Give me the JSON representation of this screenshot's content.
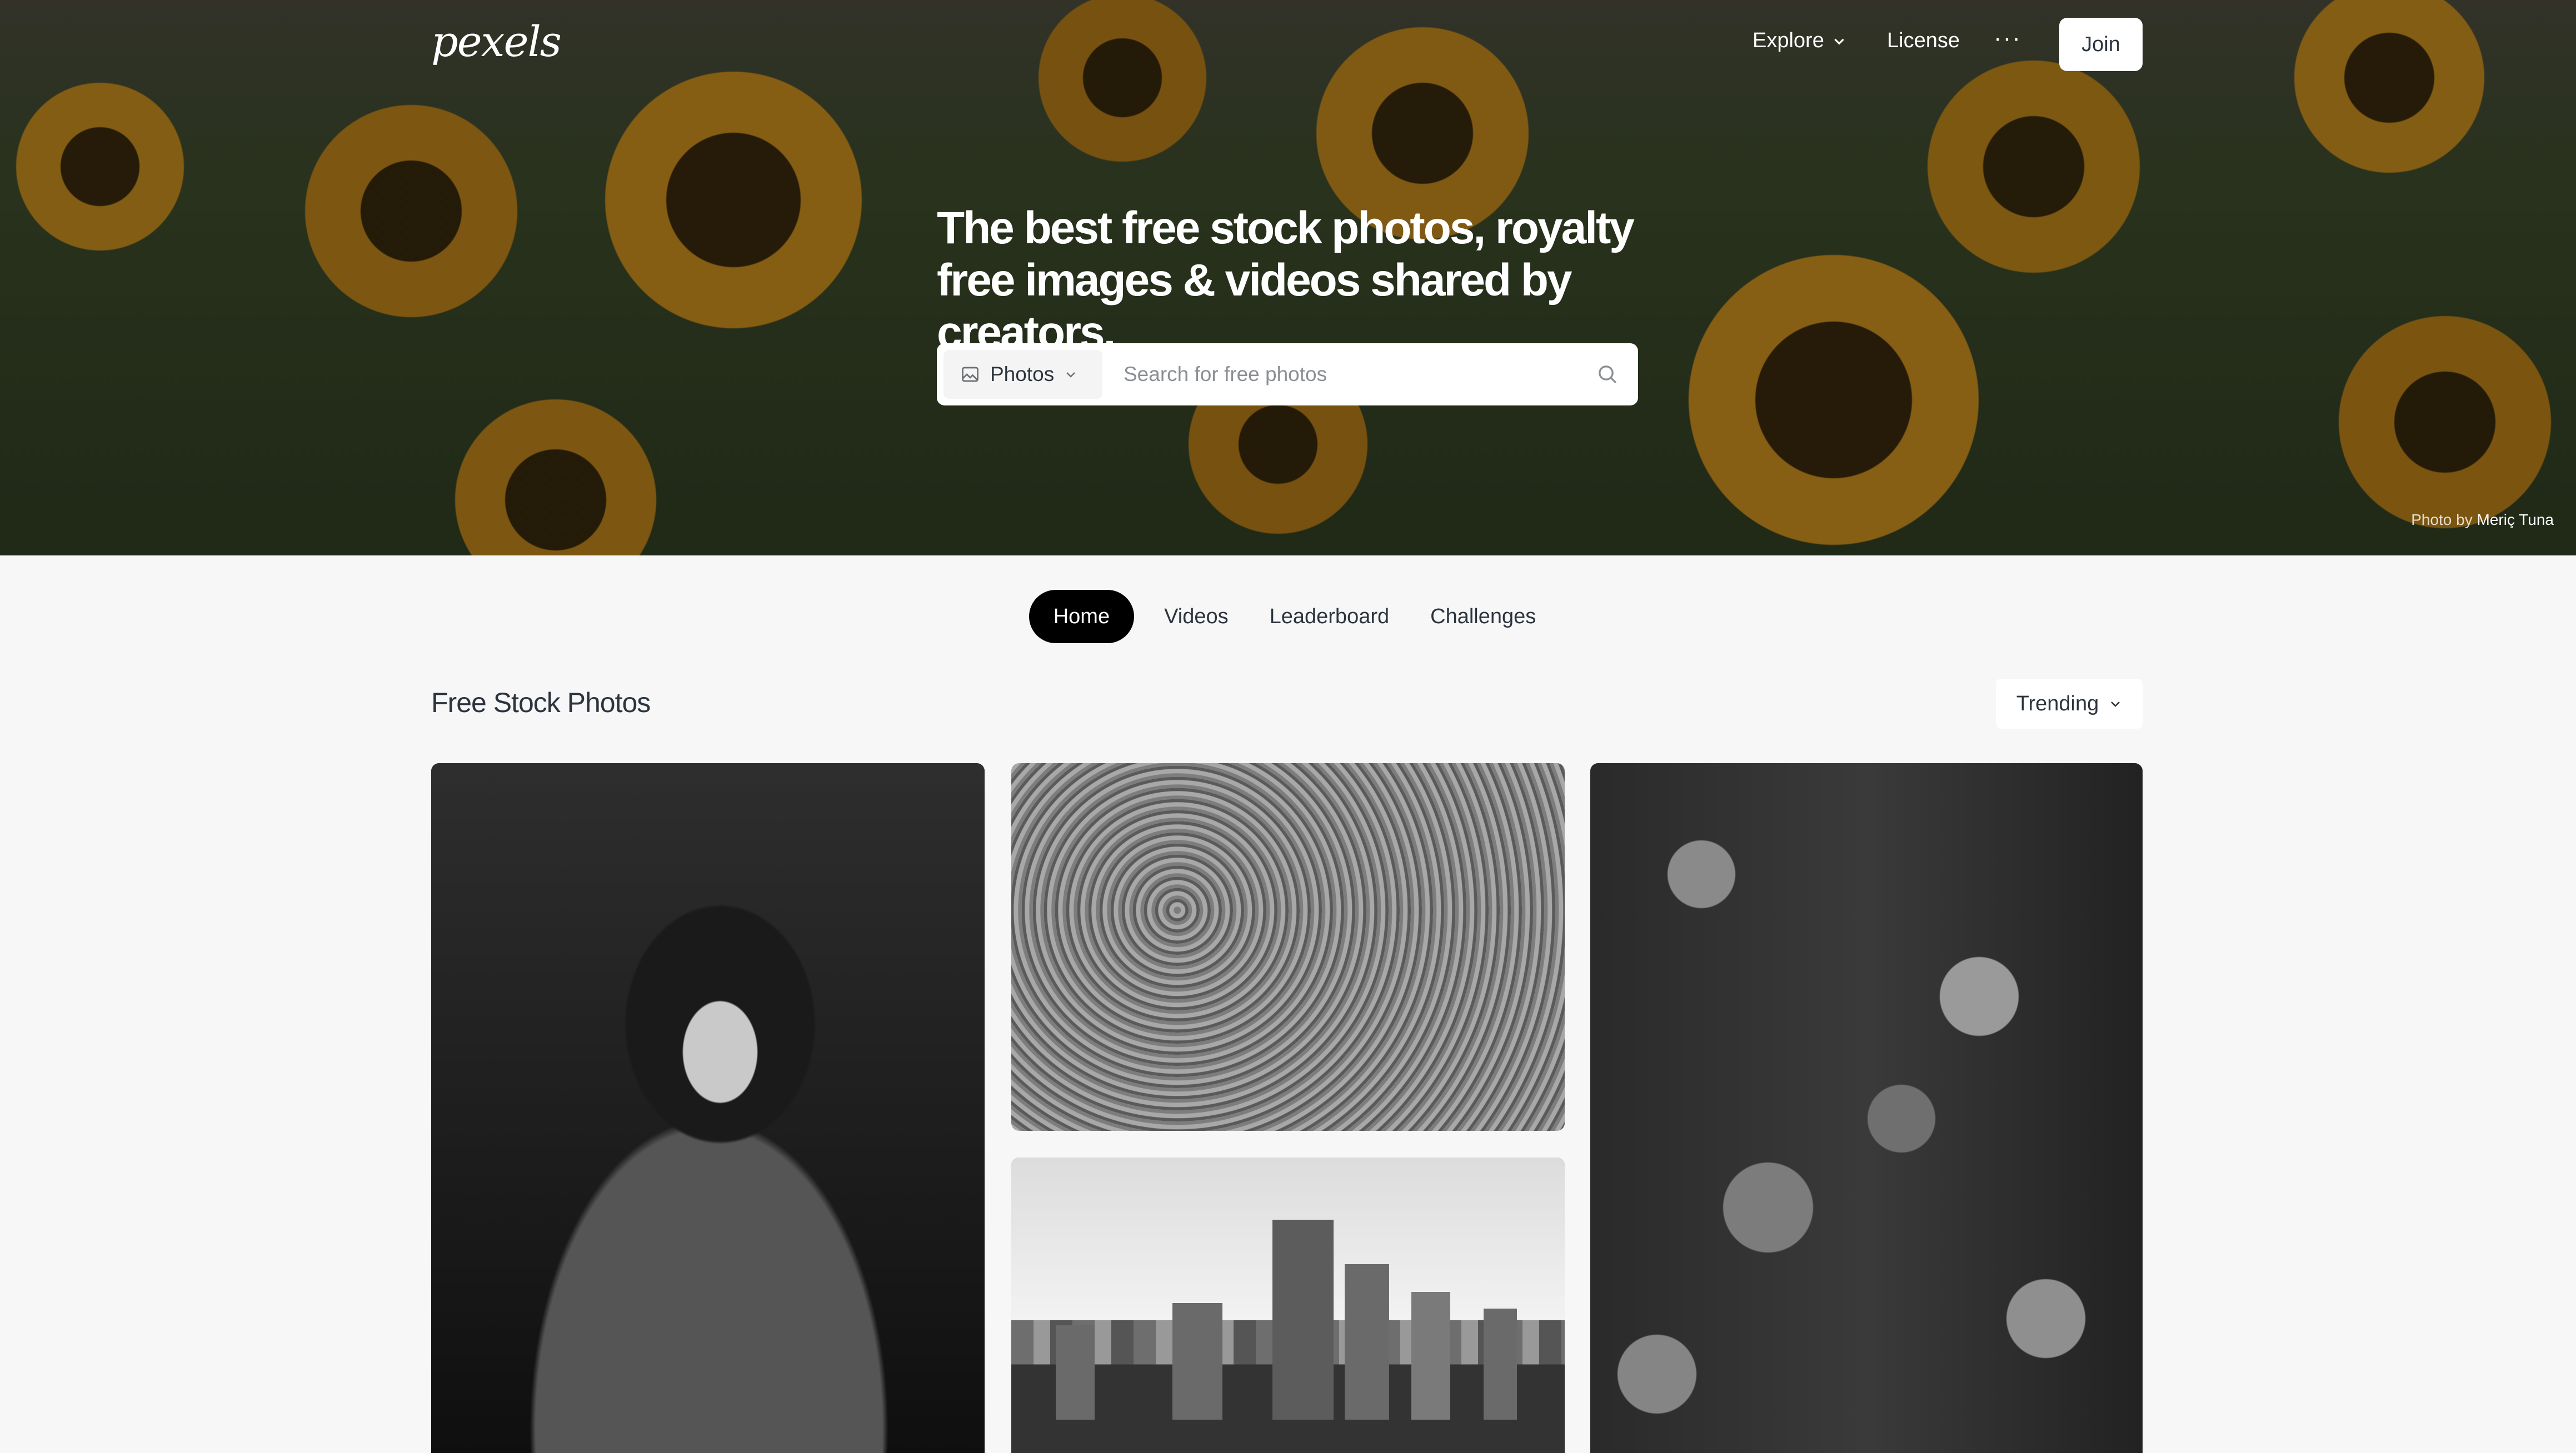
{
  "brand": {
    "logo_text": "pexels"
  },
  "nav": {
    "explore_label": "Explore",
    "license_label": "License",
    "more_label": "···",
    "join_label": "Join"
  },
  "hero": {
    "headline": "The best free stock photos, royalty free images & videos shared by creators.",
    "search": {
      "type_label": "Photos",
      "placeholder": "Search for free photos"
    },
    "credit_prefix": "Photo by",
    "credit_author": "Meriç Tuna"
  },
  "tabs": [
    {
      "label": "Home",
      "active": true
    },
    {
      "label": "Videos",
      "active": false
    },
    {
      "label": "Leaderboard",
      "active": false
    },
    {
      "label": "Challenges",
      "active": false
    }
  ],
  "section": {
    "title": "Free Stock Photos",
    "sort_label": "Trending"
  },
  "icons": {
    "photo": "image-icon",
    "chevron": "chevron-down-icon",
    "search": "search-icon"
  },
  "colors": {
    "active_tab_bg": "#000000",
    "page_bg": "#f7f7f7",
    "text": "#2c343e"
  }
}
